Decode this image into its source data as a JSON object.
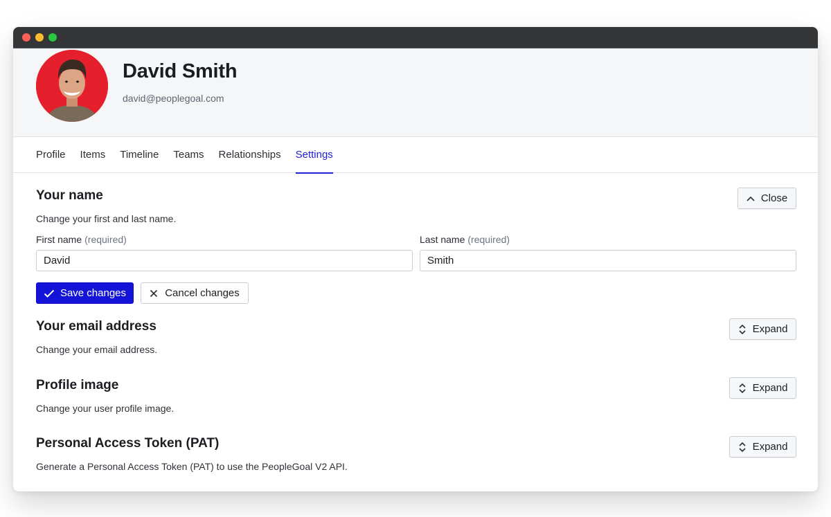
{
  "profile": {
    "name": "David Smith",
    "email": "david@peoplegoal.com"
  },
  "tabs": [
    {
      "label": "Profile",
      "active": false
    },
    {
      "label": "Items",
      "active": false
    },
    {
      "label": "Timeline",
      "active": false
    },
    {
      "label": "Teams",
      "active": false
    },
    {
      "label": "Relationships",
      "active": false
    },
    {
      "label": "Settings",
      "active": true
    }
  ],
  "sections": {
    "name": {
      "title": "Your name",
      "description": "Change your first and last name.",
      "toggle_label": "Close",
      "first_name_label": "First name",
      "last_name_label": "Last name",
      "required_text": "(required)",
      "first_name_value": "David",
      "last_name_value": "Smith",
      "save_label": "Save changes",
      "cancel_label": "Cancel changes"
    },
    "email": {
      "title": "Your email address",
      "description": "Change your email address.",
      "toggle_label": "Expand"
    },
    "image": {
      "title": "Profile image",
      "description": "Change your user profile image.",
      "toggle_label": "Expand"
    },
    "pat": {
      "title": "Personal Access Token (PAT)",
      "description": "Generate a Personal Access Token (PAT) to use the PeopleGoal V2 API.",
      "toggle_label": "Expand"
    }
  },
  "colors": {
    "accent": "#1414d9",
    "avatar_bg": "#e5202c",
    "titlebar": "#333537"
  },
  "icons": {
    "close": "chevron-up-icon",
    "expand": "chevron-up-down-icon",
    "save": "check-icon",
    "cancel": "x-icon"
  }
}
